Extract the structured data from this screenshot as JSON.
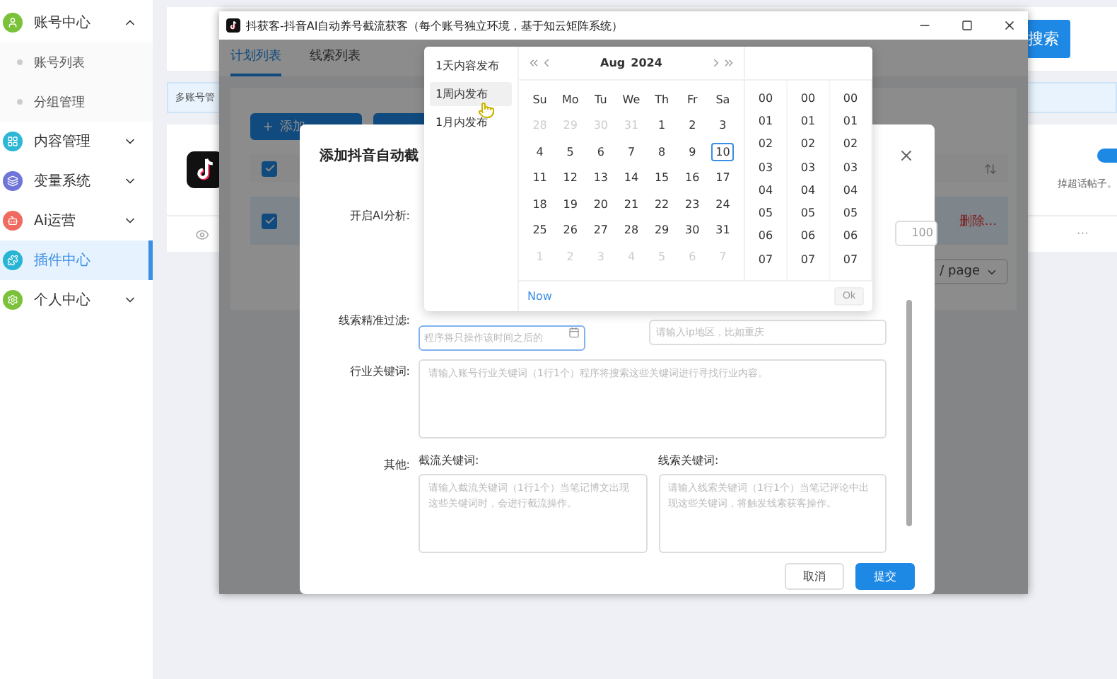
{
  "sidebar": {
    "items": [
      {
        "label": "账号中心",
        "color": "#7cc13a",
        "expanded": true,
        "selected": false,
        "children": [
          {
            "label": "账号列表"
          },
          {
            "label": "分组管理"
          }
        ]
      },
      {
        "label": "内容管理",
        "color": "#2db7d5",
        "expanded": false,
        "selected": false
      },
      {
        "label": "变量系统",
        "color": "#6f74d8",
        "expanded": false,
        "selected": false
      },
      {
        "label": "Ai运营",
        "color": "#ef6b5f",
        "expanded": false,
        "selected": false
      },
      {
        "label": "插件中心",
        "color": "#28b4d4",
        "selected": true
      },
      {
        "label": "个人中心",
        "color": "#7cc13a",
        "expanded": false,
        "selected": false
      }
    ]
  },
  "background": {
    "search_button": "搜索",
    "tab": "多账号管",
    "side_text": "掉超话帖子。",
    "more": "···"
  },
  "window": {
    "title": "抖获客-抖音AI自动养号截流获客（每个账号独立环境，基于知云矩阵系统）",
    "tabs": [
      {
        "label": "计划列表",
        "selected": true
      },
      {
        "label": "线索列表",
        "selected": false
      }
    ],
    "add_button": "添加",
    "rows": [
      {
        "checked": true
      },
      {
        "checked": true
      }
    ],
    "row_action": "删除...",
    "page_size": "/ page"
  },
  "modal": {
    "title": "添加抖音自动截",
    "ai_label": "开启AI分析:",
    "ai_count": "100",
    "filter_label": "线索精准过滤:",
    "date_placeholder": "程序将只操作该时间之后的",
    "region_placeholder": "请输入ip地区，比如重庆",
    "industry_label": "行业关键词:",
    "industry_placeholder": "请输入账号行业关键词（1行1个）程序将搜索这些关键词进行寻找行业内容。",
    "other_label": "其他:",
    "intercept_label": "截流关键词:",
    "lead_label": "线索关键词:",
    "intercept_placeholder": "请输入截流关键词（1行1个）当笔记博文出现这些关键词时，会进行截流操作。",
    "lead_placeholder": "请输入线索关键词（1行1个）当笔记评论中出现这些关键词，将触发线索获客操作。",
    "buttons": [
      {
        "label": "取消",
        "kind": "default"
      },
      {
        "label": "提交",
        "kind": "primary"
      }
    ]
  },
  "picker": {
    "presets": [
      {
        "label": "1天内容发布",
        "selected": false
      },
      {
        "label": "1周内发布",
        "selected": true
      },
      {
        "label": "1月内发布",
        "selected": false
      }
    ],
    "month": "Aug",
    "year": "2024",
    "weekdays": [
      "Su",
      "Mo",
      "Tu",
      "We",
      "Th",
      "Fr",
      "Sa"
    ],
    "weeks": [
      [
        {
          "d": "28",
          "muted": true,
          "selected": false
        },
        {
          "d": "29",
          "muted": true,
          "selected": false
        },
        {
          "d": "30",
          "muted": true,
          "selected": false
        },
        {
          "d": "31",
          "muted": true,
          "selected": false
        },
        {
          "d": "1",
          "muted": false,
          "selected": false
        },
        {
          "d": "2",
          "muted": false,
          "selected": false
        },
        {
          "d": "3",
          "muted": false,
          "selected": false
        }
      ],
      [
        {
          "d": "4",
          "muted": false,
          "selected": false
        },
        {
          "d": "5",
          "muted": false,
          "selected": false
        },
        {
          "d": "6",
          "muted": false,
          "selected": false
        },
        {
          "d": "7",
          "muted": false,
          "selected": false
        },
        {
          "d": "8",
          "muted": false,
          "selected": false
        },
        {
          "d": "9",
          "muted": false,
          "selected": false
        },
        {
          "d": "10",
          "muted": false,
          "selected": true
        }
      ],
      [
        {
          "d": "11",
          "muted": false,
          "selected": false
        },
        {
          "d": "12",
          "muted": false,
          "selected": false
        },
        {
          "d": "13",
          "muted": false,
          "selected": false
        },
        {
          "d": "14",
          "muted": false,
          "selected": false
        },
        {
          "d": "15",
          "muted": false,
          "selected": false
        },
        {
          "d": "16",
          "muted": false,
          "selected": false
        },
        {
          "d": "17",
          "muted": false,
          "selected": false
        }
      ],
      [
        {
          "d": "18",
          "muted": false,
          "selected": false
        },
        {
          "d": "19",
          "muted": false,
          "selected": false
        },
        {
          "d": "20",
          "muted": false,
          "selected": false
        },
        {
          "d": "21",
          "muted": false,
          "selected": false
        },
        {
          "d": "22",
          "muted": false,
          "selected": false
        },
        {
          "d": "23",
          "muted": false,
          "selected": false
        },
        {
          "d": "24",
          "muted": false,
          "selected": false
        }
      ],
      [
        {
          "d": "25",
          "muted": false,
          "selected": false
        },
        {
          "d": "26",
          "muted": false,
          "selected": false
        },
        {
          "d": "27",
          "muted": false,
          "selected": false
        },
        {
          "d": "28",
          "muted": false,
          "selected": false
        },
        {
          "d": "29",
          "muted": false,
          "selected": false
        },
        {
          "d": "30",
          "muted": false,
          "selected": false
        },
        {
          "d": "31",
          "muted": false,
          "selected": false
        }
      ],
      [
        {
          "d": "1",
          "muted": true,
          "selected": false
        },
        {
          "d": "2",
          "muted": true,
          "selected": false
        },
        {
          "d": "3",
          "muted": true,
          "selected": false
        },
        {
          "d": "4",
          "muted": true,
          "selected": false
        },
        {
          "d": "5",
          "muted": true,
          "selected": false
        },
        {
          "d": "6",
          "muted": true,
          "selected": false
        },
        {
          "d": "7",
          "muted": true,
          "selected": false
        }
      ]
    ],
    "time_columns": [
      [
        "00",
        "01",
        "02",
        "03",
        "04",
        "05",
        "06",
        "07"
      ],
      [
        "00",
        "01",
        "02",
        "03",
        "04",
        "05",
        "06",
        "07"
      ],
      [
        "00",
        "01",
        "02",
        "03",
        "04",
        "05",
        "06",
        "07"
      ]
    ],
    "now": "Now",
    "ok": {
      "label": "Ok",
      "disabled": true
    }
  }
}
